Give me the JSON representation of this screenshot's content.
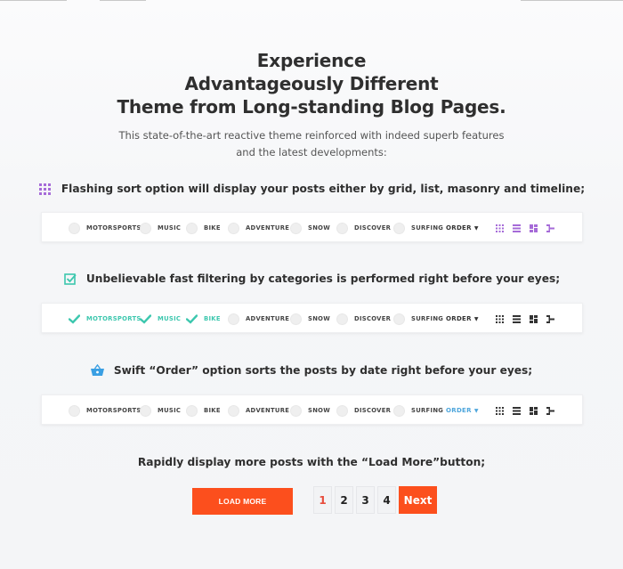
{
  "hero": {
    "title_lines": [
      "Experience",
      "Advantageously Different",
      "Theme from Long-standing Blog Pages."
    ],
    "subtitle_lines": [
      "This state-of-the-art reactive theme reinforced with indeed superb features",
      "and the latest developments:"
    ]
  },
  "features": [
    {
      "icon": "grid-icon",
      "text": "Flashing sort option will display your posts either by grid, list, masonry and timeline;",
      "icon_color": "#a66bd8"
    },
    {
      "icon": "checkbox-icon",
      "text": "Unbelievable fast filtering by categories is performed right before your eyes;",
      "icon_color": "#3cc7ae"
    },
    {
      "icon": "basket-icon",
      "text": "Swift “Order” option sorts the posts by date right before your eyes;",
      "icon_color": "#3a9fe3"
    }
  ],
  "filter_bars": [
    {
      "categories": [
        {
          "label": "MOTORSPORTS",
          "checked": false
        },
        {
          "label": "MUSIC",
          "checked": false
        },
        {
          "label": "BIKE",
          "checked": false
        },
        {
          "label": "ADVENTURE",
          "checked": false
        },
        {
          "label": "SNOW",
          "checked": false
        },
        {
          "label": "DISCOVER",
          "checked": false
        },
        {
          "label": "SURFING",
          "checked": false
        }
      ],
      "order_label": "ORDER",
      "order_active": false,
      "view_icons_color": "#a66bd8",
      "view_icons": [
        "grid-view-icon",
        "list-view-icon",
        "masonry-view-icon",
        "timeline-view-icon"
      ]
    },
    {
      "categories": [
        {
          "label": "MOTORSPORTS",
          "checked": true
        },
        {
          "label": "MUSIC",
          "checked": true
        },
        {
          "label": "BIKE",
          "checked": true
        },
        {
          "label": "ADVENTURE",
          "checked": false
        },
        {
          "label": "SNOW",
          "checked": false
        },
        {
          "label": "DISCOVER",
          "checked": false
        },
        {
          "label": "SURFING",
          "checked": false
        }
      ],
      "order_label": "ORDER",
      "order_active": false,
      "view_icons_color": "#333333",
      "view_icons": [
        "grid-view-icon",
        "list-view-icon",
        "masonry-view-icon",
        "timeline-view-icon"
      ]
    },
    {
      "categories": [
        {
          "label": "MOTORSPORTS",
          "checked": false
        },
        {
          "label": "MUSIC",
          "checked": false
        },
        {
          "label": "BIKE",
          "checked": false
        },
        {
          "label": "ADVENTURE",
          "checked": false
        },
        {
          "label": "SNOW",
          "checked": false
        },
        {
          "label": "DISCOVER",
          "checked": false
        },
        {
          "label": "SURFING",
          "checked": false
        }
      ],
      "order_label": "ORDER",
      "order_active": true,
      "view_icons_color": "#333333",
      "view_icons": [
        "grid-view-icon",
        "list-view-icon",
        "masonry-view-icon",
        "timeline-view-icon"
      ]
    }
  ],
  "load_more": {
    "caption": "Rapidly display more posts with the “Load More”button;",
    "button_label": "LOAD MORE",
    "accent_color": "#fc4f1d"
  },
  "pagination": {
    "pages": [
      "1",
      "2",
      "3",
      "4"
    ],
    "current": "1",
    "next_label": "Next"
  }
}
